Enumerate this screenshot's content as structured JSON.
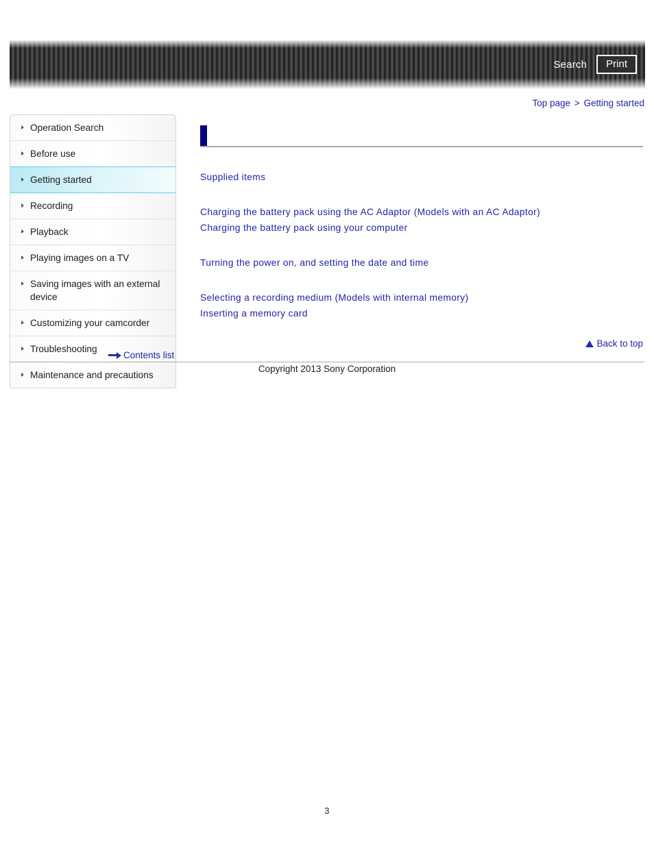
{
  "header": {
    "search_label": "Search",
    "print_label": "Print"
  },
  "breadcrumb": {
    "top_page": "Top page",
    "separator": ">",
    "current": "Getting started"
  },
  "sidebar": {
    "items": [
      {
        "label": "Operation Search",
        "active": false
      },
      {
        "label": "Before use",
        "active": false
      },
      {
        "label": "Getting started",
        "active": true
      },
      {
        "label": "Recording",
        "active": false
      },
      {
        "label": "Playback",
        "active": false
      },
      {
        "label": "Playing images on a TV",
        "active": false
      },
      {
        "label": "Saving images with an external device",
        "active": false
      },
      {
        "label": "Customizing your camcorder",
        "active": false
      },
      {
        "label": "Troubleshooting",
        "active": false
      },
      {
        "label": "Maintenance and precautions",
        "active": false
      }
    ],
    "contents_list_label": "Contents list"
  },
  "main": {
    "page_title": "",
    "groups": [
      {
        "links": [
          "Supplied items"
        ]
      },
      {
        "links": [
          "Charging the battery pack using the AC Adaptor (Models with an AC Adaptor)",
          "Charging the battery pack using your computer"
        ]
      },
      {
        "links": [
          "Turning the power on, and setting the date and time"
        ]
      },
      {
        "links": [
          "Selecting a recording medium (Models with internal memory)",
          "Inserting a memory card"
        ]
      }
    ],
    "back_to_top_label": "Back to top"
  },
  "footer": {
    "copyright": "Copyright 2013 Sony Corporation",
    "page_number": "3"
  },
  "colors": {
    "link_blue": "#2222aa",
    "title_navy": "#000082",
    "active_cyan": "#64cde3",
    "header_dark": "#262626"
  }
}
